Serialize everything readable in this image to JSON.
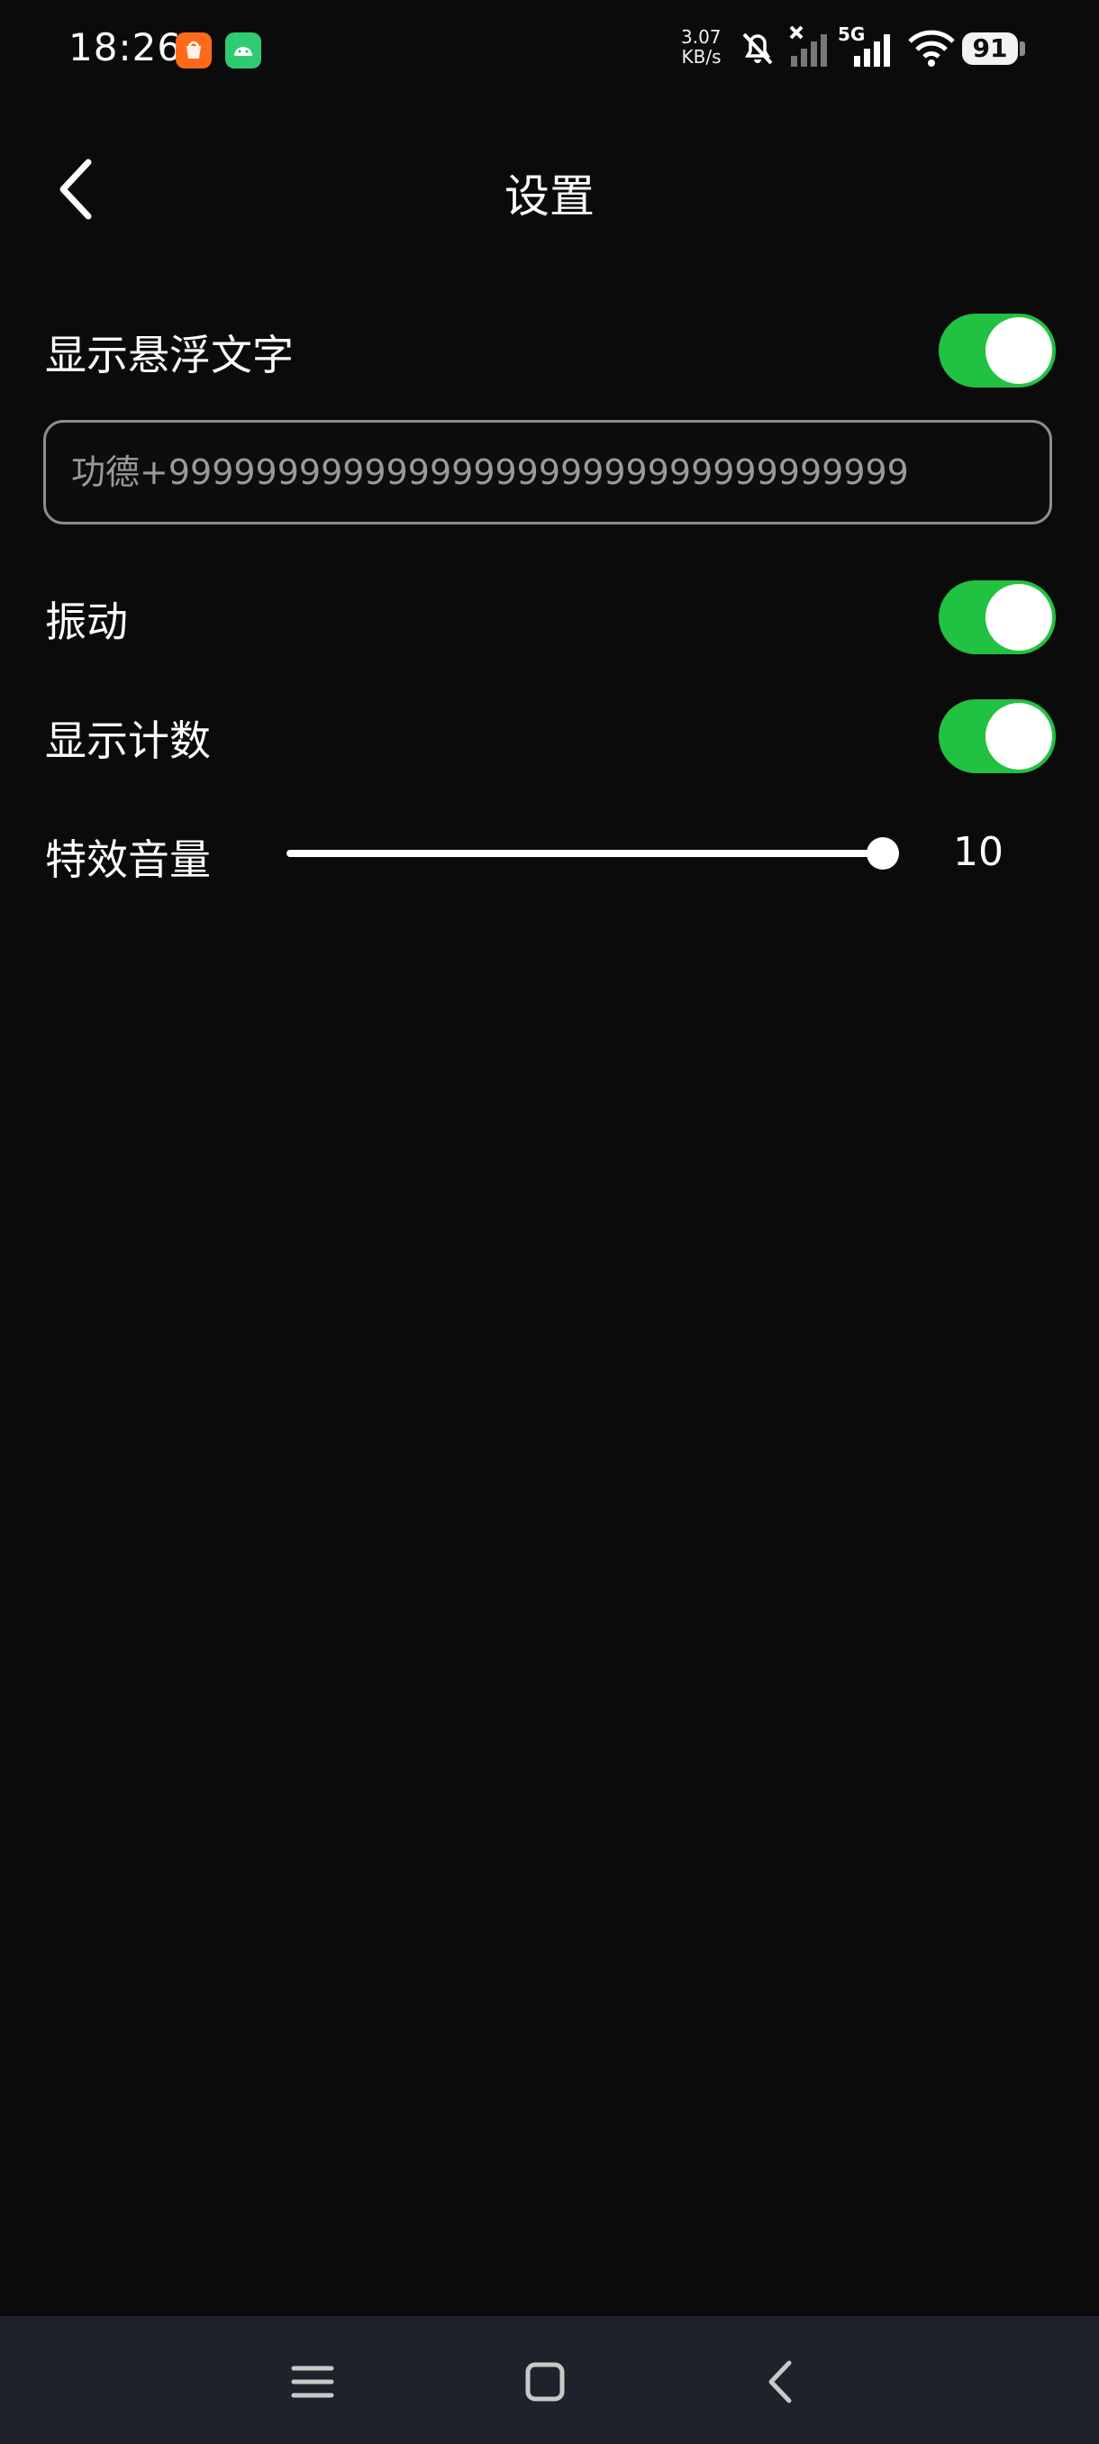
{
  "status_bar": {
    "time": "18:26",
    "network_speed_value": "3.07",
    "network_speed_unit": "KB/s",
    "network_type": "5G",
    "battery": "91",
    "icons": [
      "shopping-app-icon",
      "android-app-icon",
      "mute-icon",
      "no-signal-icon",
      "signal-icon",
      "wifi-icon",
      "battery-icon"
    ]
  },
  "header": {
    "title": "设置",
    "back_icon": "chevron-left-icon"
  },
  "settings": {
    "show_floating_text": {
      "label": "显示悬浮文字",
      "enabled": true
    },
    "floating_text_input": {
      "value": "",
      "placeholder": "功德+9999999999999999999999999999999999"
    },
    "vibration": {
      "label": "振动",
      "enabled": true
    },
    "show_count": {
      "label": "显示计数",
      "enabled": true
    },
    "effect_volume": {
      "label": "特效音量",
      "value": "10",
      "min": 0,
      "max": 10
    }
  },
  "nav_bar": {
    "icons": [
      "menu-icon",
      "home-icon",
      "back-icon"
    ]
  },
  "colors": {
    "background": "#0b0b0c",
    "accent_green": "#21c141",
    "nav_bar": "#1e222b"
  }
}
